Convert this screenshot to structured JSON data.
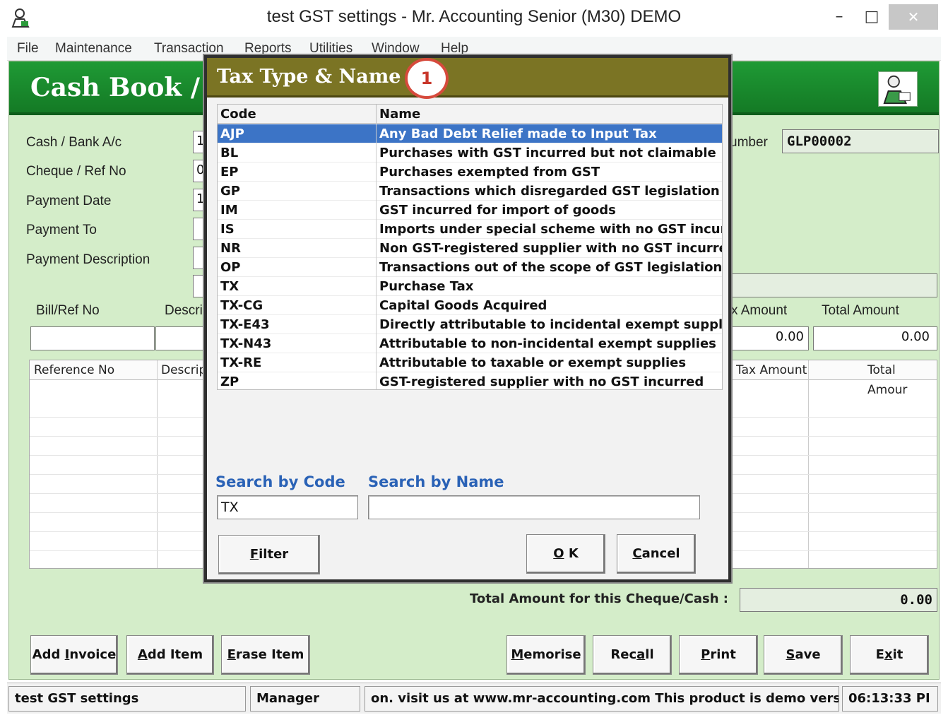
{
  "window": {
    "title": "test GST settings - Mr. Accounting Senior (M30) DEMO",
    "min_glyph": "–",
    "max_glyph": "□",
    "close_glyph": "✕"
  },
  "menu": [
    "File",
    "Maintenance",
    "Transaction",
    "Reports",
    "Utilities",
    "Window",
    "Help"
  ],
  "form": {
    "header_title": "Cash Book / B",
    "labels": {
      "cash_bank": "Cash / Bank A/c",
      "cheque_ref": "Cheque / Ref No",
      "payment_date": "Payment Date",
      "payment_to": "Payment To",
      "payment_desc": "Payment Description",
      "number": "umber"
    },
    "field_values": {
      "cash_bank": "1",
      "cheque_ref": "0",
      "payment_date": "1",
      "number": "GLP00002"
    },
    "entry_headers": {
      "bill_ref": "Bill/Ref No",
      "descr": "Descri",
      "tax_amount": "x Amount",
      "total_amount": "Total Amount"
    },
    "entry_values": {
      "tax_amount": "0.00",
      "total_amount": "0.00"
    },
    "grid_headers": {
      "reference": "Reference No",
      "descr": "Descrip",
      "tax_amount": "Tax Amount",
      "total_amount": "Total Amour"
    },
    "total_label": "Total Amount for this  Cheque/Cash :",
    "total_value": "0.00",
    "buttons": {
      "add_invoice": {
        "pre": "Add ",
        "key": "I",
        "post": "nvoice"
      },
      "add_item": {
        "pre": "",
        "key": "A",
        "post": "dd Item"
      },
      "erase_item": {
        "pre": "",
        "key": "E",
        "post": "rase Item"
      },
      "memorise": {
        "pre": "",
        "key": "M",
        "post": "emorise"
      },
      "recall": {
        "pre": "Rec",
        "key": "a",
        "post": "ll"
      },
      "print": {
        "pre": "",
        "key": "P",
        "post": "rint"
      },
      "save": {
        "pre": "",
        "key": "S",
        "post": "ave"
      },
      "exit": {
        "pre": "E",
        "key": "x",
        "post": "it"
      }
    }
  },
  "status": {
    "company": "test GST settings",
    "user": "Manager",
    "message": "on.  visit us at www.mr-accounting.com This product is demo versi",
    "time": "06:13:33 PI"
  },
  "dialog": {
    "title": "Tax Type & Name",
    "badge": "1",
    "col_code": "Code",
    "col_name": "Name",
    "rows": [
      {
        "code": "AJP",
        "name": "Any Bad Debt Relief  made to Input Tax"
      },
      {
        "code": "BL",
        "name": "Purchases with GST incurred but not claimable"
      },
      {
        "code": "EP",
        "name": "Purchases exempted from GST"
      },
      {
        "code": "GP",
        "name": "Transactions which disregarded GST legislation"
      },
      {
        "code": "IM",
        "name": "GST incurred for import of goods"
      },
      {
        "code": "IS",
        "name": "Imports under special scheme with no GST incurred"
      },
      {
        "code": "NR",
        "name": "Non GST-registered supplier with no GST incurred"
      },
      {
        "code": "OP",
        "name": "Transactions out of the scope of GST legislation"
      },
      {
        "code": "TX",
        "name": "Purchase Tax"
      },
      {
        "code": "TX-CG",
        "name": "Capital Goods Acquired"
      },
      {
        "code": "TX-E43",
        "name": "Directly attributable to incidental exempt supplie"
      },
      {
        "code": "TX-N43",
        "name": "Attributable to non-incidental exempt supplies"
      },
      {
        "code": "TX-RE",
        "name": "Attributable to taxable or exempt supplies"
      },
      {
        "code": "ZP",
        "name": "GST-registered supplier with no GST incurred"
      }
    ],
    "search_code_label": "Search by Code",
    "search_name_label": "Search by Name",
    "search_code_value": "TX",
    "search_name_value": "",
    "filter": {
      "pre": "",
      "key": "F",
      "post": "ilter"
    },
    "ok": {
      "pre": "",
      "key": "O",
      "post": " K"
    },
    "cancel": {
      "pre": "",
      "key": "C",
      "post": "ancel"
    }
  }
}
